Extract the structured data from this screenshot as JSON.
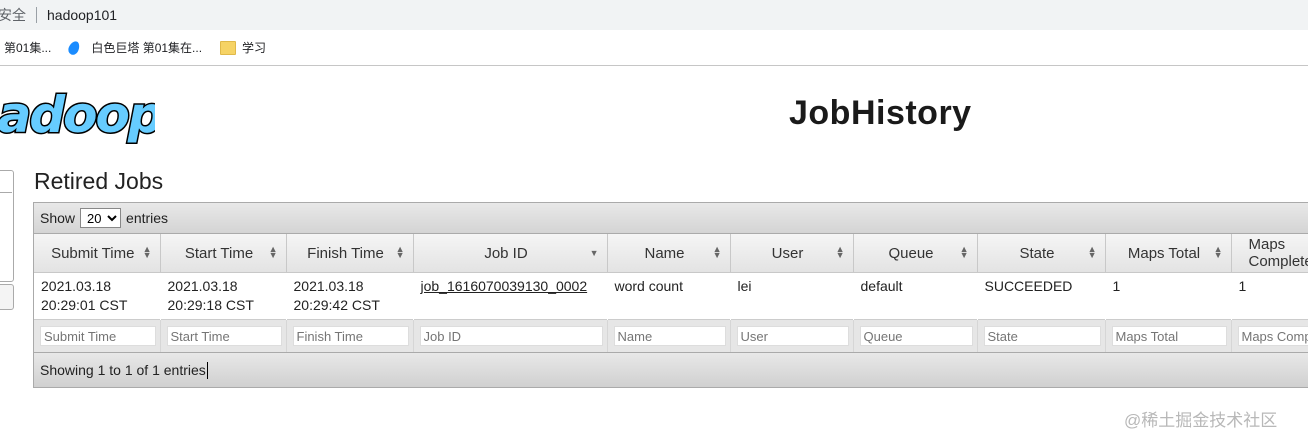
{
  "browser": {
    "security_label": "安全",
    "url": "hadoop101",
    "bookmarks": [
      {
        "label": "第01集...",
        "icon": "bookmark-icon"
      },
      {
        "label": "白色巨塔 第01集在...",
        "icon": "water-drop-icon"
      },
      {
        "label": "学习",
        "icon": "folder-icon"
      }
    ]
  },
  "header": {
    "logo_text": "hadoop",
    "title": "JobHistory"
  },
  "section": {
    "title": "Retired Jobs"
  },
  "table": {
    "length_prefix": "Show",
    "length_value": "20",
    "length_options": [
      "20"
    ],
    "length_suffix": "entries",
    "columns": [
      "Submit Time",
      "Start Time",
      "Finish Time",
      "Job ID",
      "Name",
      "User",
      "Queue",
      "State",
      "Maps Total",
      "Maps Completed"
    ],
    "rows": [
      {
        "submit_time": [
          "2021.03.18",
          "20:29:01 CST"
        ],
        "start_time": [
          "2021.03.18",
          "20:29:18 CST"
        ],
        "finish_time": [
          "2021.03.18",
          "20:29:42 CST"
        ],
        "job_id": "job_1616070039130_0002",
        "name": "word count",
        "user": "lei",
        "queue": "default",
        "state": "SUCCEEDED",
        "maps_total": "1",
        "maps_completed": "1"
      }
    ],
    "filters": [
      "Submit Time",
      "Start Time",
      "Finish Time",
      "Job ID",
      "Name",
      "User",
      "Queue",
      "State",
      "Maps Total",
      "Maps Completed"
    ],
    "info": "Showing 1 to 1 of 1 entries"
  },
  "watermark": "@稀土掘金技术社区",
  "colors": {
    "logo_fill": "#66ccff",
    "logo_stroke": "#000000"
  }
}
